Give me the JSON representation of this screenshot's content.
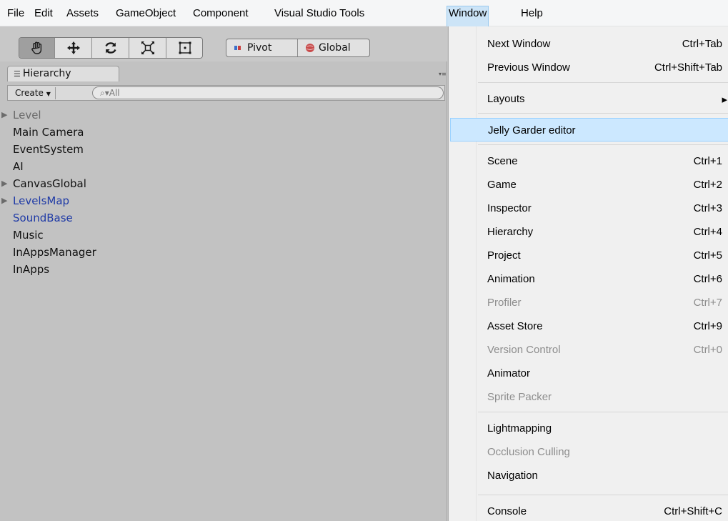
{
  "menubar": {
    "items": [
      "File",
      "Edit",
      "Assets",
      "GameObject",
      "Component",
      "Visual Studio Tools",
      "Window",
      "Help"
    ],
    "active": "Window"
  },
  "toolbar": {
    "transform_tools": [
      "hand-tool-icon",
      "move-tool-icon",
      "rotate-tool-icon",
      "scale-tool-icon",
      "rect-tool-icon"
    ],
    "pivot_label": "Pivot",
    "global_label": "Global"
  },
  "hierarchy": {
    "tab_label": "Hierarchy",
    "create_label": "Create",
    "search_placeholder": "All",
    "items": [
      {
        "label": "Level",
        "expandable": true,
        "style": "gray"
      },
      {
        "label": "Main Camera",
        "expandable": false,
        "style": "normal"
      },
      {
        "label": "EventSystem",
        "expandable": false,
        "style": "normal"
      },
      {
        "label": "AI",
        "expandable": false,
        "style": "normal"
      },
      {
        "label": "CanvasGlobal",
        "expandable": true,
        "style": "normal"
      },
      {
        "label": "LevelsMap",
        "expandable": true,
        "style": "blue"
      },
      {
        "label": "SoundBase",
        "expandable": false,
        "style": "blue"
      },
      {
        "label": "Music",
        "expandable": false,
        "style": "normal"
      },
      {
        "label": "InAppsManager",
        "expandable": false,
        "style": "normal"
      },
      {
        "label": "InApps",
        "expandable": false,
        "style": "normal"
      }
    ]
  },
  "window_menu": {
    "items": [
      {
        "label": "Next Window",
        "shortcut": "Ctrl+Tab",
        "enabled": true
      },
      {
        "label": "Previous Window",
        "shortcut": "Ctrl+Shift+Tab",
        "enabled": true
      },
      {
        "label": "Layouts",
        "shortcut": "",
        "enabled": true,
        "submenu": true
      },
      {
        "label": "Jelly Garder editor",
        "shortcut": "",
        "enabled": true,
        "highlighted": true
      },
      {
        "label": "Scene",
        "shortcut": "Ctrl+1",
        "enabled": true
      },
      {
        "label": "Game",
        "shortcut": "Ctrl+2",
        "enabled": true
      },
      {
        "label": "Inspector",
        "shortcut": "Ctrl+3",
        "enabled": true
      },
      {
        "label": "Hierarchy",
        "shortcut": "Ctrl+4",
        "enabled": true
      },
      {
        "label": "Project",
        "shortcut": "Ctrl+5",
        "enabled": true
      },
      {
        "label": "Animation",
        "shortcut": "Ctrl+6",
        "enabled": true
      },
      {
        "label": "Profiler",
        "shortcut": "Ctrl+7",
        "enabled": false
      },
      {
        "label": "Asset Store",
        "shortcut": "Ctrl+9",
        "enabled": true
      },
      {
        "label": "Version Control",
        "shortcut": "Ctrl+0",
        "enabled": false
      },
      {
        "label": "Animator",
        "shortcut": "",
        "enabled": true
      },
      {
        "label": "Sprite Packer",
        "shortcut": "",
        "enabled": false
      },
      {
        "label": "Lightmapping",
        "shortcut": "",
        "enabled": true
      },
      {
        "label": "Occlusion Culling",
        "shortcut": "",
        "enabled": false
      },
      {
        "label": "Navigation",
        "shortcut": "",
        "enabled": true
      },
      {
        "label": "Console",
        "shortcut": "Ctrl+Shift+C",
        "enabled": true
      }
    ]
  }
}
